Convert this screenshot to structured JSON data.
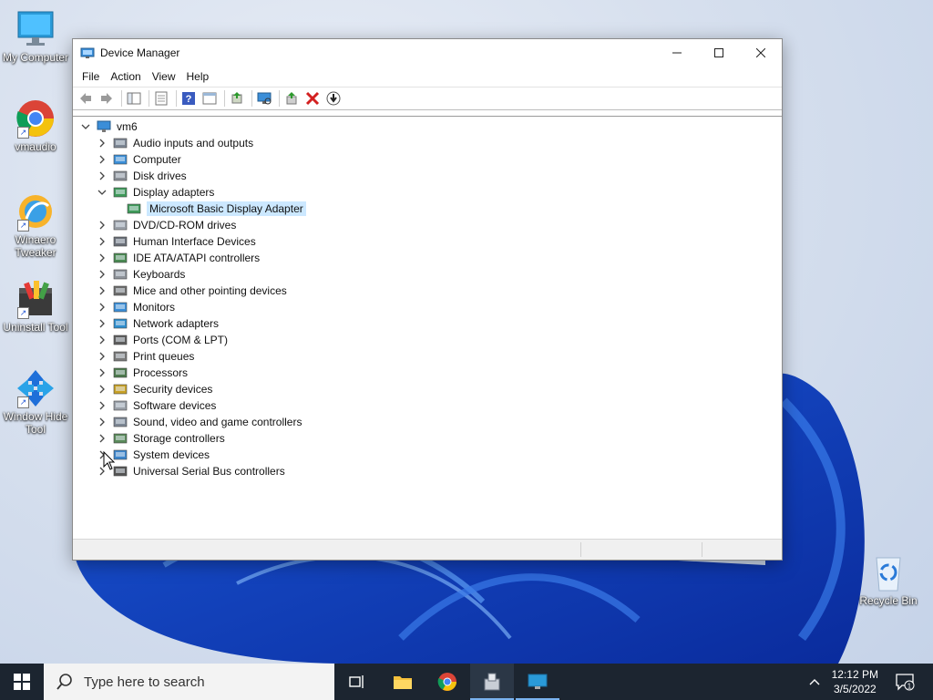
{
  "desktop": {
    "icons": [
      {
        "label": "My Computer"
      },
      {
        "label": "vmaudio"
      },
      {
        "label": "Winaero Tweaker"
      },
      {
        "label": "Uninstall Tool"
      },
      {
        "label": "Window Hide Tool"
      },
      {
        "label": "Recycle Bin"
      }
    ]
  },
  "window": {
    "title": "Device Manager",
    "menu": [
      "File",
      "Action",
      "View",
      "Help"
    ],
    "tree": {
      "root": "vm6",
      "items": [
        {
          "label": "Audio inputs and outputs",
          "icon": "speaker-icon"
        },
        {
          "label": "Computer",
          "icon": "computer-icon"
        },
        {
          "label": "Disk drives",
          "icon": "disk-drive-icon"
        },
        {
          "label": "Display adapters",
          "icon": "display-adapter-icon",
          "expanded": true
        },
        {
          "label": "Microsoft Basic Display Adapter",
          "icon": "display-adapter-icon",
          "child": true,
          "selected": true
        },
        {
          "label": "DVD/CD-ROM drives",
          "icon": "dvd-drive-icon"
        },
        {
          "label": "Human Interface Devices",
          "icon": "hid-icon"
        },
        {
          "label": "IDE ATA/ATAPI controllers",
          "icon": "ide-controller-icon"
        },
        {
          "label": "Keyboards",
          "icon": "keyboard-icon"
        },
        {
          "label": "Mice and other pointing devices",
          "icon": "mouse-icon"
        },
        {
          "label": "Monitors",
          "icon": "monitor-icon"
        },
        {
          "label": "Network adapters",
          "icon": "network-adapter-icon"
        },
        {
          "label": "Ports (COM & LPT)",
          "icon": "port-icon"
        },
        {
          "label": "Print queues",
          "icon": "printer-icon"
        },
        {
          "label": "Processors",
          "icon": "processor-icon"
        },
        {
          "label": "Security devices",
          "icon": "security-device-icon"
        },
        {
          "label": "Software devices",
          "icon": "software-device-icon"
        },
        {
          "label": "Sound, video and game controllers",
          "icon": "sound-icon"
        },
        {
          "label": "Storage controllers",
          "icon": "storage-controller-icon"
        },
        {
          "label": "System devices",
          "icon": "system-devices-icon"
        },
        {
          "label": "Universal Serial Bus controllers",
          "icon": "usb-icon"
        }
      ]
    }
  },
  "taskbar": {
    "search_placeholder": "Type here to search",
    "time": "12:12 PM",
    "date": "3/5/2022",
    "notification_count": "1"
  },
  "colors": {
    "selection": "#cce8ff",
    "taskbar": "#1c2530",
    "accent": "#0078d4"
  }
}
